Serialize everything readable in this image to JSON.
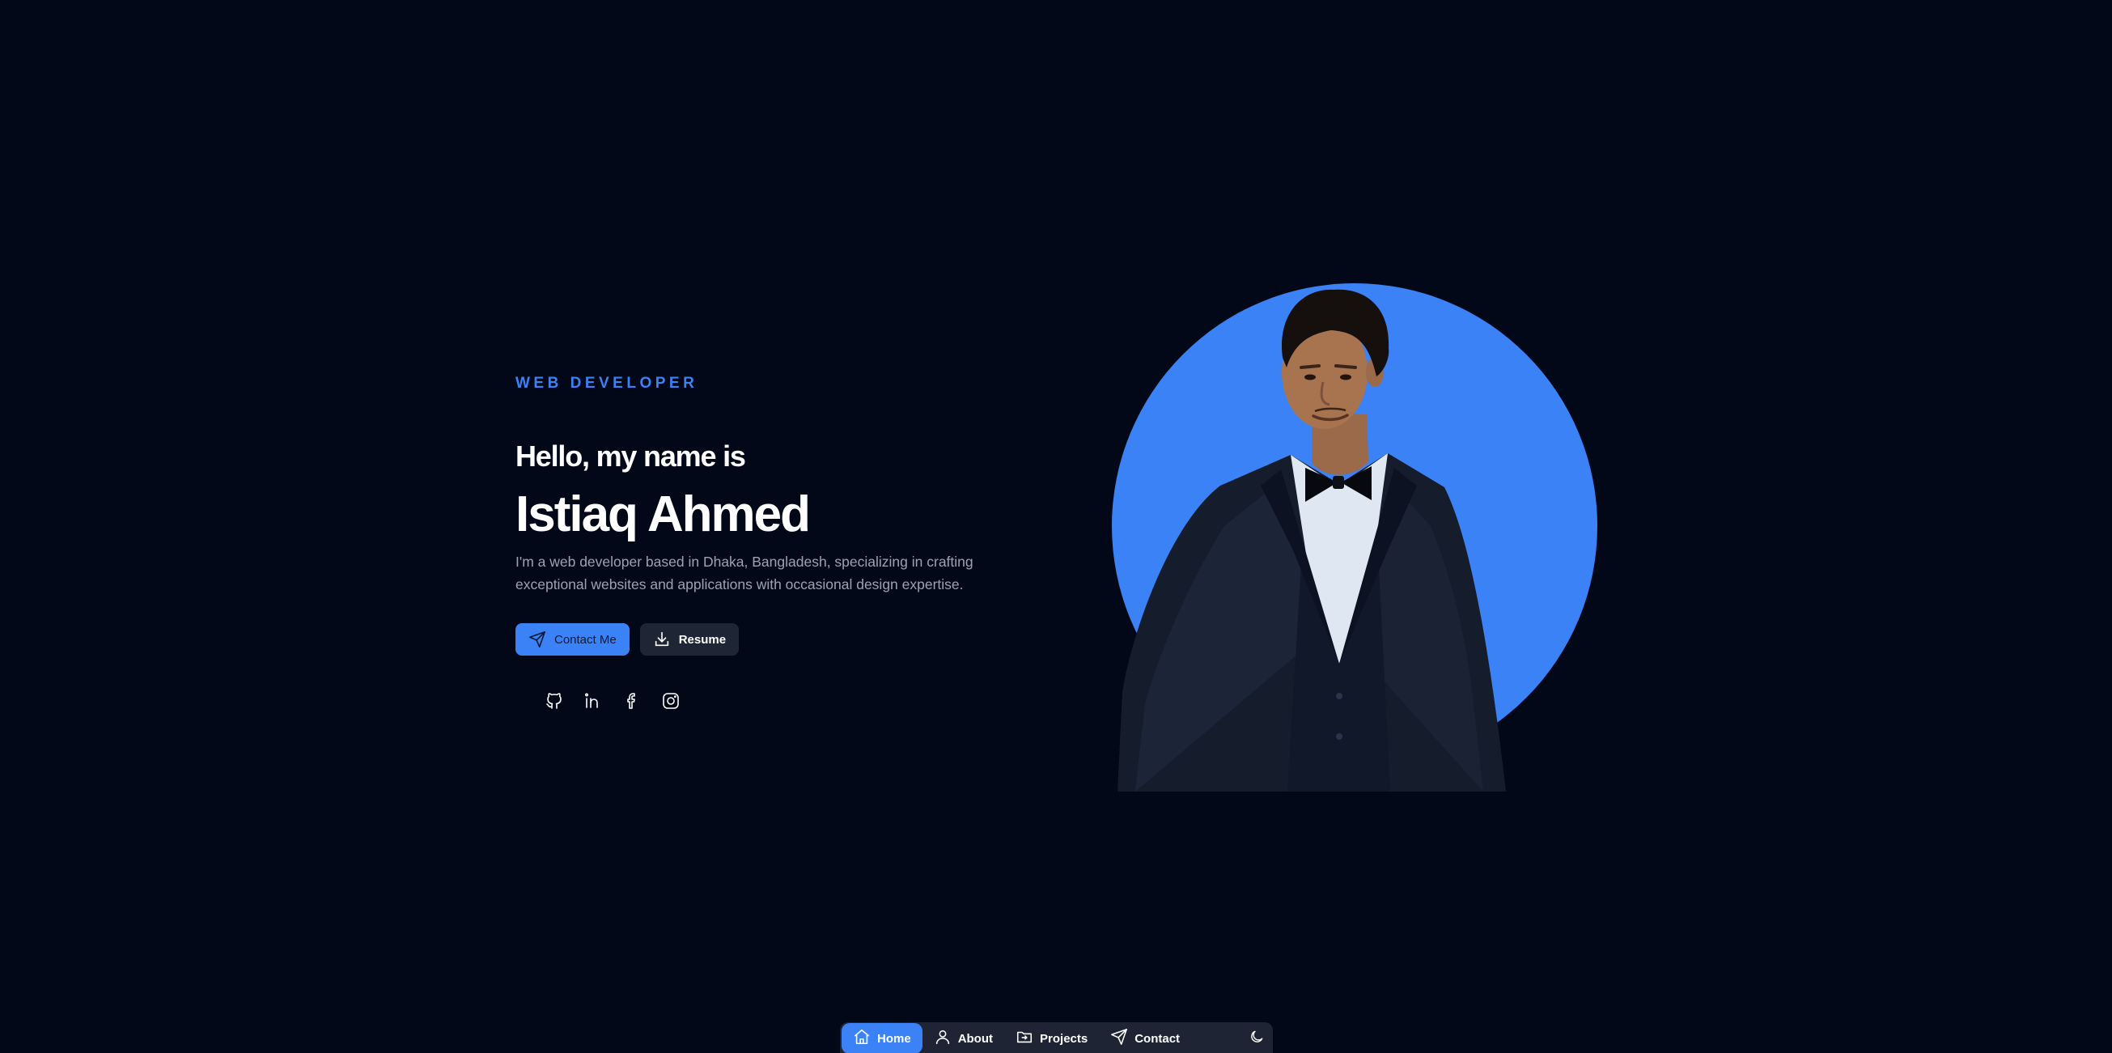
{
  "hero": {
    "role": "WEB DEVELOPER",
    "greeting": "Hello, my name is",
    "name": "Istiaq Ahmed",
    "bio": "I'm a web developer based in Dhaka, Bangladesh, specializing in crafting exceptional websites and applications with occasional design expertise.",
    "contact_label": "Contact Me",
    "resume_label": "Resume",
    "socials": [
      {
        "icon": "github-icon"
      },
      {
        "icon": "linkedin-icon"
      },
      {
        "icon": "facebook-icon"
      },
      {
        "icon": "instagram-icon"
      }
    ]
  },
  "dock": {
    "items": [
      {
        "label": "Home",
        "icon": "home-icon",
        "active": true
      },
      {
        "label": "About",
        "icon": "user-icon",
        "active": false
      },
      {
        "label": "Projects",
        "icon": "folder-icon",
        "active": false
      },
      {
        "label": "Contact",
        "icon": "send-icon",
        "active": false
      }
    ],
    "theme_icon": "moon-icon"
  },
  "colors": {
    "background": "#030819",
    "accent": "#3b82f6",
    "muted_text": "#9ca3af",
    "dock_bg": "#1e2433"
  }
}
